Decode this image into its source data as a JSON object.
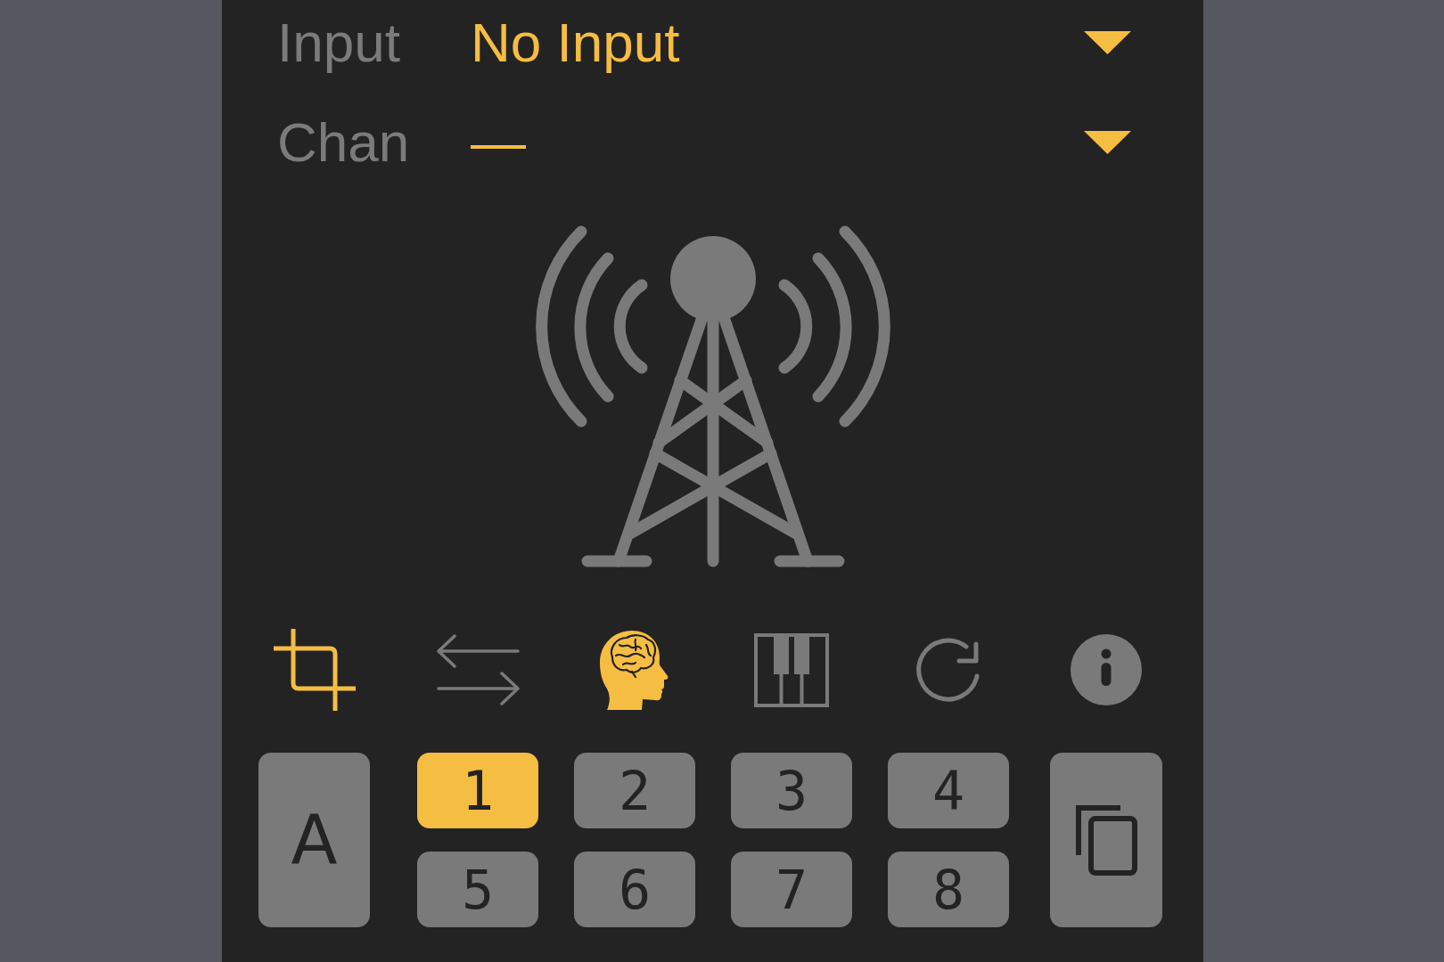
{
  "fields": [
    {
      "label": "Input",
      "value": "No Input"
    },
    {
      "label": "Chan",
      "value": "—"
    }
  ],
  "tools": [
    {
      "kind": "crop",
      "on": true
    },
    {
      "kind": "swap",
      "on": false
    },
    {
      "kind": "brain",
      "on": true
    },
    {
      "kind": "piano",
      "on": false
    },
    {
      "kind": "refresh",
      "on": false
    },
    {
      "kind": "info",
      "on": false
    }
  ],
  "bank_button": {
    "label": "A"
  },
  "pads": [
    {
      "label": "1",
      "selected": true
    },
    {
      "label": "2",
      "selected": false
    },
    {
      "label": "3",
      "selected": false
    },
    {
      "label": "4",
      "selected": false
    },
    {
      "label": "5",
      "selected": false
    },
    {
      "label": "6",
      "selected": false
    },
    {
      "label": "7",
      "selected": false
    },
    {
      "label": "8",
      "selected": false
    }
  ]
}
